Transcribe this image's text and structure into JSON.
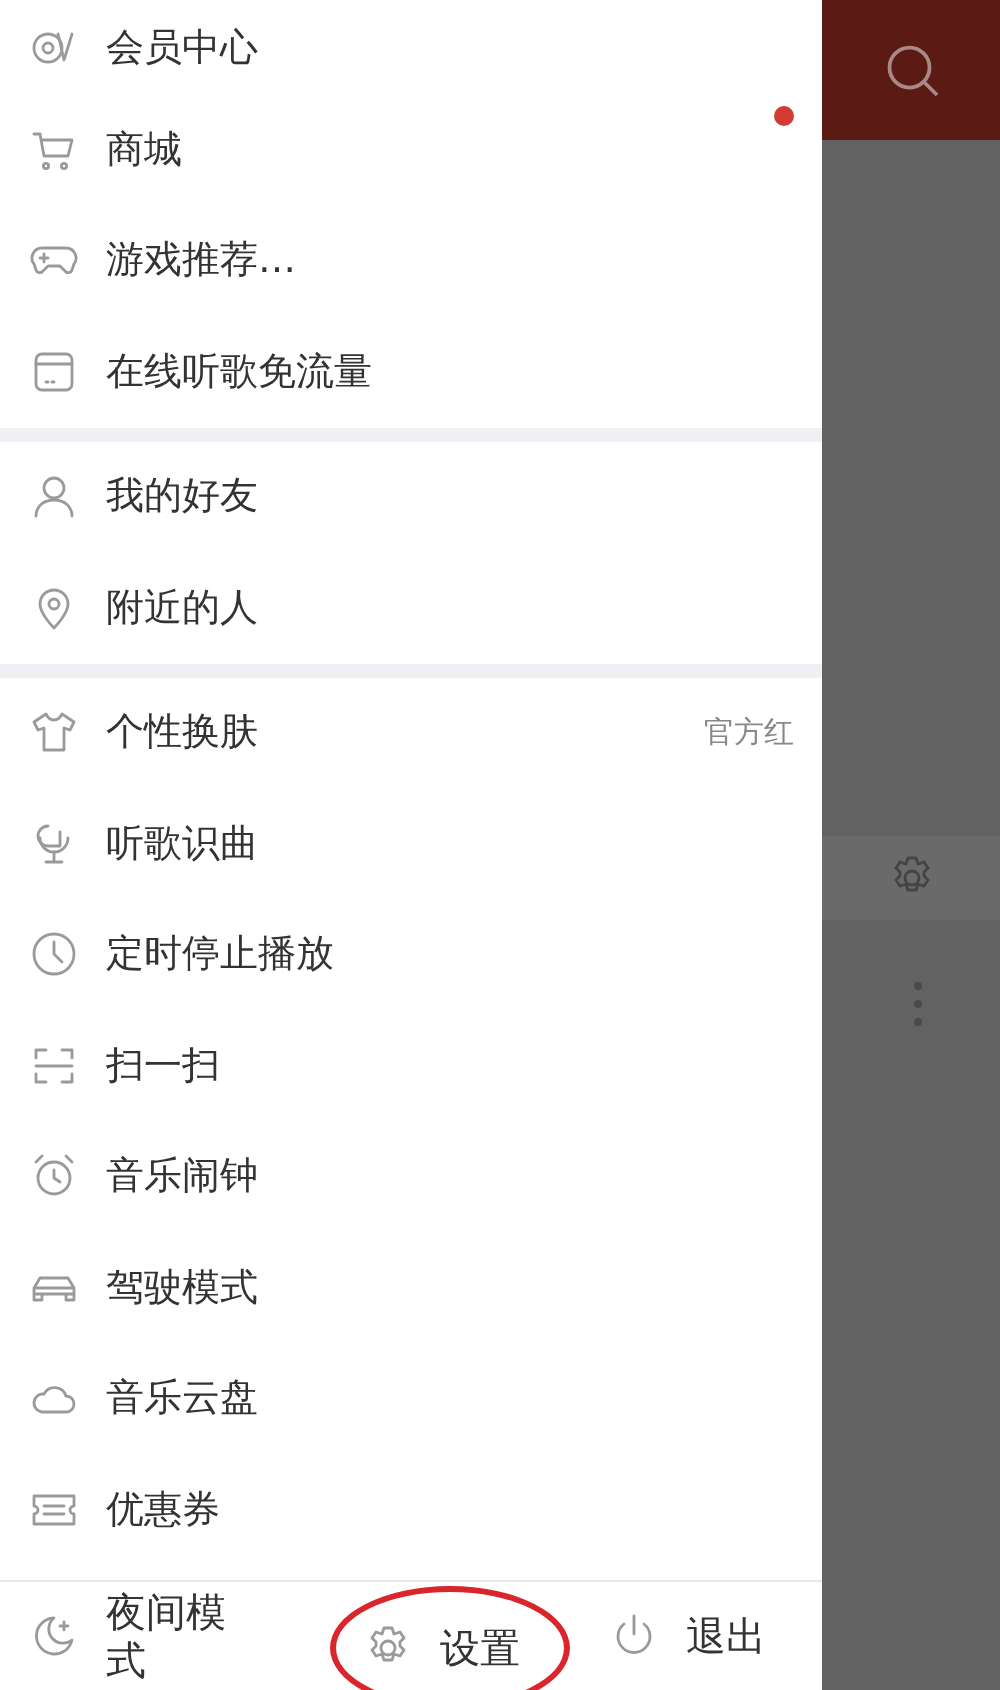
{
  "drawer": {
    "sections": [
      {
        "items": [
          {
            "label": "会员中心"
          },
          {
            "label": "商城",
            "badge": true
          },
          {
            "label": "游戏推荐…"
          },
          {
            "label": "在线听歌免流量"
          }
        ]
      },
      {
        "items": [
          {
            "label": "我的好友"
          },
          {
            "label": "附近的人"
          }
        ]
      },
      {
        "items": [
          {
            "label": "个性换肤",
            "value": "官方红"
          },
          {
            "label": "听歌识曲"
          },
          {
            "label": "定时停止播放"
          },
          {
            "label": "扫一扫"
          },
          {
            "label": "音乐闹钟"
          },
          {
            "label": "驾驶模式"
          },
          {
            "label": "音乐云盘"
          },
          {
            "label": "优惠券"
          }
        ]
      }
    ],
    "footer": [
      {
        "label": "夜间模式",
        "circled": false
      },
      {
        "label": "设置",
        "circled": true
      },
      {
        "label": "退出",
        "circled": false
      }
    ]
  }
}
